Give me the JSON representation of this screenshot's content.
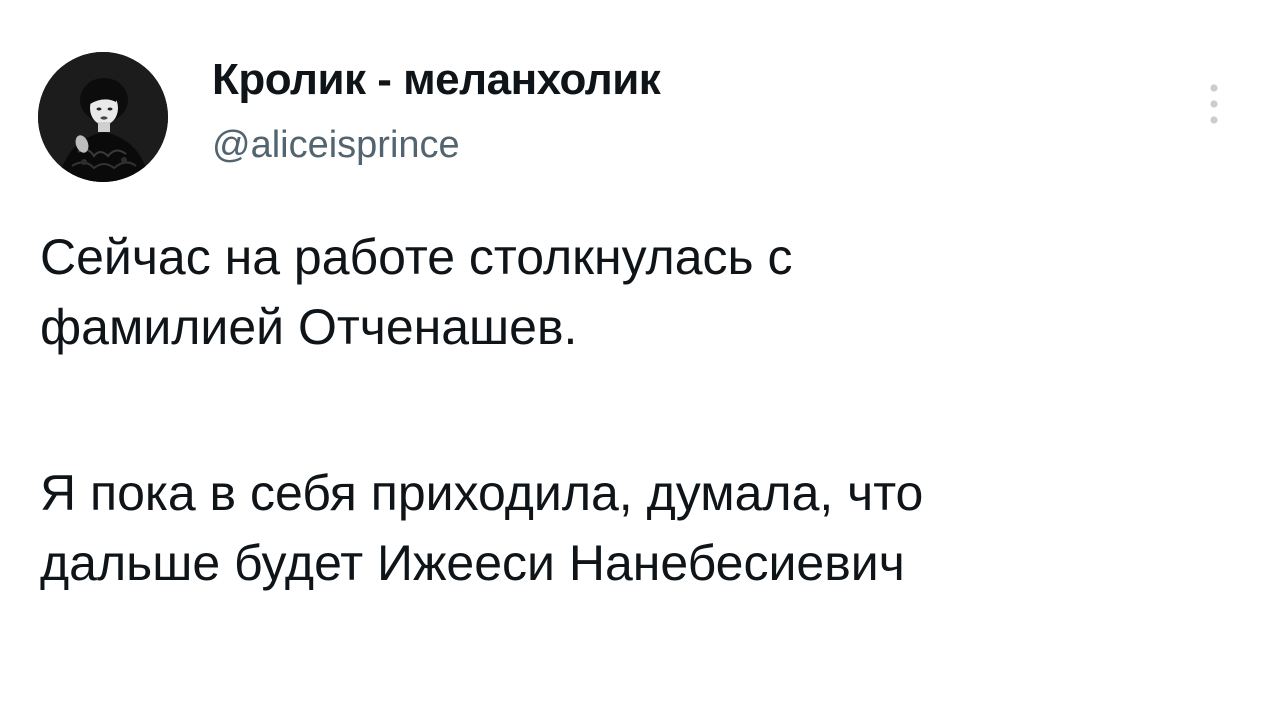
{
  "author": {
    "name": "Кролик - меланхолик",
    "handle": "@aliceisprince"
  },
  "tweet": {
    "paragraph1_line1": "Сейчас на работе столкнулась с",
    "paragraph1_line2": "фамилией Отченашев.",
    "paragraph2_line1": "Я пока в себя приходила, думала, что",
    "paragraph2_line2": "дальше будет Ижееси Нанебесиевич"
  },
  "icons": {
    "avatar": "profile-photo",
    "more": "more-vertical-icon"
  },
  "colors": {
    "text": "#0f1419",
    "secondary": "#536471",
    "background": "#ffffff"
  }
}
